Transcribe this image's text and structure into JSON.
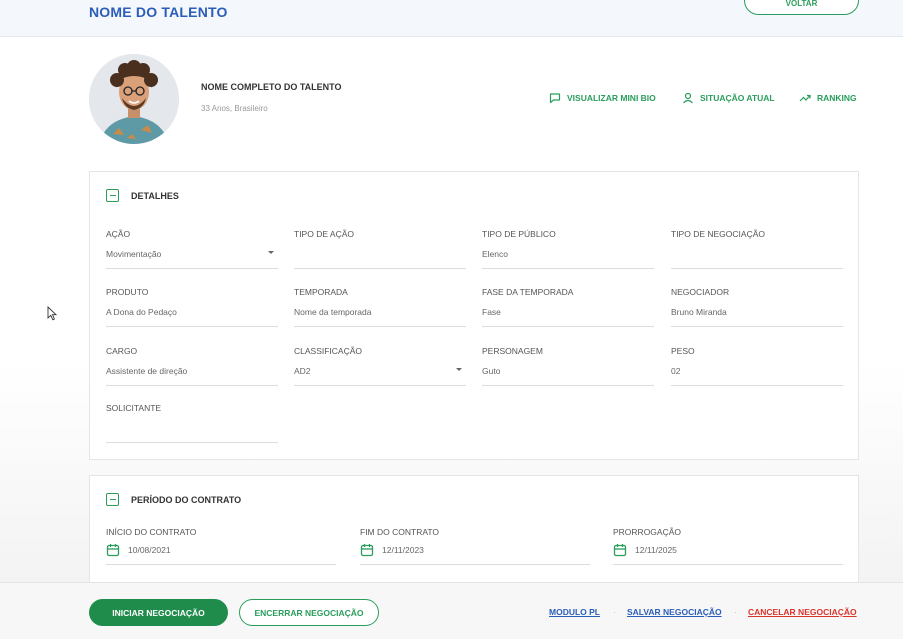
{
  "header": {
    "title": "NOME DO TALENTO",
    "back_label": "VOLTAR"
  },
  "profile": {
    "name": "NOME COMPLETO DO TALENTO",
    "subtitle": "33 Anos, Brasileiro",
    "actions": [
      {
        "label": "VISUALIZAR MINI BIO",
        "icon": "chat-bubble-icon"
      },
      {
        "label": "SITUAÇÃO ATUAL",
        "icon": "user-icon"
      },
      {
        "label": "RANKING",
        "icon": "trending-up-icon"
      }
    ]
  },
  "details": {
    "title": "DETALHES",
    "fields": [
      {
        "label": "AÇÃO",
        "value": "Movimentação",
        "dropdown": true
      },
      {
        "label": "TIPO DE AÇÃO",
        "value": ""
      },
      {
        "label": "TIPO DE PÚBLICO",
        "value": "Elenco"
      },
      {
        "label": "TIPO DE NEGOCIAÇÃO",
        "value": ""
      },
      {
        "label": "PRODUTO",
        "value": "A Dona do Pedaço"
      },
      {
        "label": "TEMPORADA",
        "value": "Nome da temporada"
      },
      {
        "label": "FASE DA TEMPORADA",
        "value": "Fase"
      },
      {
        "label": "NEGOCIADOR",
        "value": "Bruno Miranda"
      },
      {
        "label": "CARGO",
        "value": "Assistente de direção"
      },
      {
        "label": "CLASSIFICAÇÃO",
        "value": "AD2",
        "dropdown": true
      },
      {
        "label": "PERSONAGEM",
        "value": "Guto"
      },
      {
        "label": "PESO",
        "value": "02"
      },
      {
        "label": "SOLICITANTE",
        "value": ""
      }
    ]
  },
  "contract": {
    "title": "PERÍODO DO CONTRATO",
    "fields": [
      {
        "label": "INÍCIO DO CONTRATO",
        "value": "10/08/2021"
      },
      {
        "label": "FIM DO CONTRATO",
        "value": "12/11/2023"
      },
      {
        "label": "PRORROGAÇÃO",
        "value": "12/11/2025"
      }
    ]
  },
  "footer": {
    "start_label": "INICIAR NEGOCIAÇÃO",
    "end_label": "ENCERRAR NEGOCIAÇÃO",
    "module_label": "MODULO PL",
    "save_label": "SALVAR NEGOCIAÇÃO",
    "cancel_label": "CANCELAR NEGOCIAÇÃO"
  },
  "colors": {
    "accent": "#2a9d5c",
    "primary_button": "#1f8c4c",
    "title": "#2b5db8",
    "link": "#2b5db8",
    "danger": "#d9342b"
  }
}
